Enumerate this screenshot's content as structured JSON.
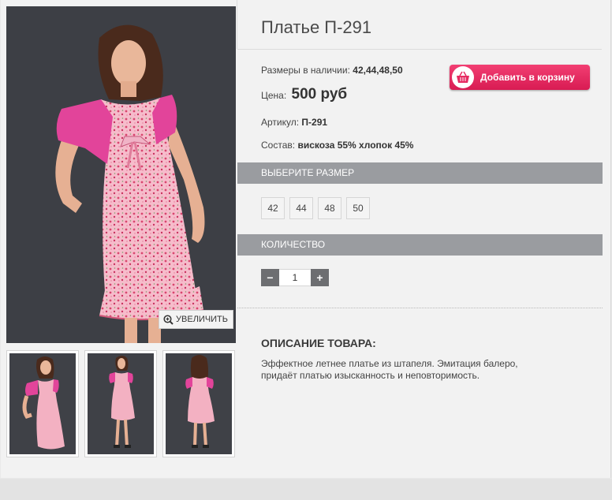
{
  "product": {
    "title": "Платье П-291",
    "sizes_label": "Размеры в наличии:",
    "sizes_value": "42,44,48,50",
    "price_label": "Цена:",
    "price_value": "500 руб",
    "article_label": "Артикул:",
    "article_value": "П-291",
    "composition_label": "Состав:",
    "composition_value": "вискоза 55% хлопок 45%"
  },
  "cart_button": {
    "label": "Добавить в корзину",
    "icon": "shopping-basket-icon",
    "color": "#e62a61"
  },
  "gallery": {
    "zoom_label": "УВЕЛИЧИТЬ",
    "zoom_icon": "zoom-in-icon",
    "thumbnails": [
      "front-view",
      "full-length-front",
      "back-view"
    ]
  },
  "size_section": {
    "header": "ВЫБЕРИТЕ РАЗМЕР",
    "options": [
      "42",
      "44",
      "48",
      "50"
    ]
  },
  "quantity_section": {
    "header": "КОЛИЧЕСТВО",
    "minus": "−",
    "plus": "+",
    "value": "1"
  },
  "description": {
    "title": "ОПИСАНИЕ ТОВАРА:",
    "line1": "Эффектное летнее платье из штапеля. Эмитация балеро,",
    "line2": "придаёт платью изысканность и неповторимость."
  },
  "colors": {
    "accent": "#e62a61",
    "section_bar": "#9a9ca0",
    "photo_bg": "#3d3f45",
    "dress_pink": "#f6b9c8",
    "bolero_pink": "#e2449a"
  }
}
